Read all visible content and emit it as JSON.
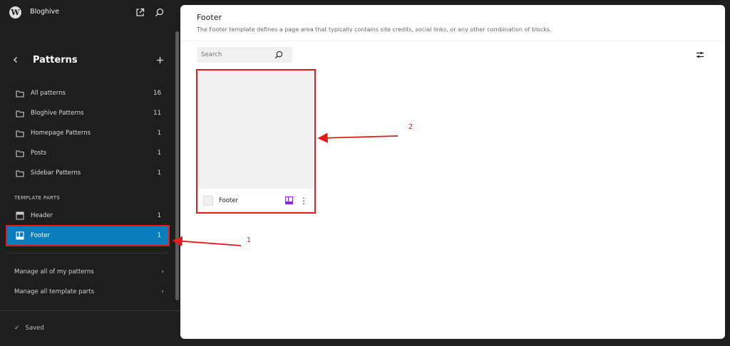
{
  "site": {
    "name": "Bloghive"
  },
  "panel": {
    "title": "Patterns"
  },
  "categories": [
    {
      "label": "All patterns",
      "count": "16"
    },
    {
      "label": "Bloghive Patterns",
      "count": "11"
    },
    {
      "label": "Homepage Patterns",
      "count": "1"
    },
    {
      "label": "Posts",
      "count": "1"
    },
    {
      "label": "Sidebar Patterns",
      "count": "1"
    }
  ],
  "template_parts": {
    "heading": "TEMPLATE PARTS",
    "items": [
      {
        "label": "Header",
        "count": "1"
      },
      {
        "label": "Footer",
        "count": "1"
      }
    ]
  },
  "manage": [
    {
      "label": "Manage all of my patterns"
    },
    {
      "label": "Manage all template parts"
    }
  ],
  "status": {
    "saved": "Saved"
  },
  "main": {
    "title": "Footer",
    "description": "The Footer template defines a page area that typically contains site credits, social links, or any other combination of blocks.",
    "search_placeholder": "Search",
    "card": {
      "title": "Footer"
    }
  },
  "annotations": {
    "one": "1",
    "two": "2"
  },
  "colors": {
    "accent": "#0a7dbf",
    "annotation": "#e01b1b",
    "badge": "#8a2be2"
  }
}
